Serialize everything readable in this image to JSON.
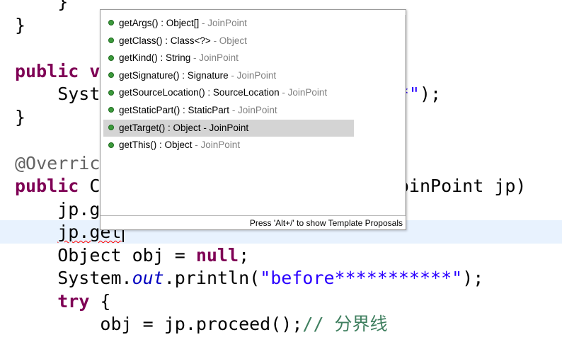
{
  "editor": {
    "lines": [
      {
        "tokens": [
          {
            "t": "    }",
            "c": ""
          }
        ]
      },
      {
        "tokens": [
          {
            "t": "}",
            "c": ""
          }
        ]
      },
      {
        "tokens": [
          {
            "t": "",
            "c": ""
          }
        ]
      },
      {
        "tokens": [
          {
            "t": "public",
            "c": "kw"
          },
          {
            "t": " v",
            "c": "kw"
          }
        ]
      },
      {
        "tokens": [
          {
            "t": "    Syst",
            "c": ""
          },
          {
            "t": "                          ***\"",
            "c": "str"
          },
          {
            "t": ");",
            "c": ""
          }
        ]
      },
      {
        "tokens": [
          {
            "t": "}",
            "c": ""
          }
        ]
      },
      {
        "tokens": [
          {
            "t": "",
            "c": ""
          }
        ]
      },
      {
        "tokens": [
          {
            "t": "@Overric",
            "c": "ann"
          }
        ]
      },
      {
        "tokens": [
          {
            "t": "public",
            "c": "kw"
          },
          {
            "t": " C",
            "c": ""
          },
          {
            "t": "                          gJoinPoint jp)",
            "c": ""
          }
        ]
      },
      {
        "tokens": [
          {
            "t": "    jp.g",
            "c": ""
          },
          {
            "t": "      ();",
            "c": ""
          }
        ]
      },
      {
        "tokens": [
          {
            "t": "    ",
            "c": ""
          },
          {
            "t": "jp.get",
            "c": "err"
          }
        ],
        "current": true,
        "caret": true
      },
      {
        "tokens": [
          {
            "t": "    Object obj = ",
            "c": ""
          },
          {
            "t": "null",
            "c": "kw"
          },
          {
            "t": ";",
            "c": ""
          }
        ]
      },
      {
        "tokens": [
          {
            "t": "    System.",
            "c": ""
          },
          {
            "t": "out",
            "c": "fld"
          },
          {
            "t": ".println(",
            "c": ""
          },
          {
            "t": "\"before***********\"",
            "c": "str"
          },
          {
            "t": ");",
            "c": ""
          }
        ]
      },
      {
        "tokens": [
          {
            "t": "    ",
            "c": ""
          },
          {
            "t": "try",
            "c": "kw"
          },
          {
            "t": " {",
            "c": ""
          }
        ]
      },
      {
        "tokens": [
          {
            "t": "        obj = jp.proceed();",
            "c": ""
          },
          {
            "t": "// 分界线",
            "c": "cmt"
          }
        ]
      }
    ]
  },
  "assist": {
    "proposals": [
      {
        "signature": "getArgs() : Object[]",
        "owner": " - JoinPoint",
        "icon": "public-method-icon"
      },
      {
        "signature": "getClass() : Class<?>",
        "owner": " - Object",
        "icon": "public-method-icon"
      },
      {
        "signature": "getKind() : String",
        "owner": " - JoinPoint",
        "icon": "public-method-icon"
      },
      {
        "signature": "getSignature() : Signature",
        "owner": " - JoinPoint",
        "icon": "public-method-icon"
      },
      {
        "signature": "getSourceLocation() : SourceLocation",
        "owner": " - JoinPoint",
        "icon": "public-method-icon"
      },
      {
        "signature": "getStaticPart() : StaticPart",
        "owner": " - JoinPoint",
        "icon": "public-method-icon"
      },
      {
        "signature": "getTarget() : Object",
        "owner": " - JoinPoint",
        "icon": "public-method-icon",
        "selected": true
      },
      {
        "signature": "getThis() : Object",
        "owner": " - JoinPoint",
        "icon": "public-method-icon"
      }
    ],
    "footer_hint": "Press 'Alt+/' to show Template Proposals"
  },
  "colors": {
    "keyword": "#7f0055",
    "string": "#2a00ff",
    "field": "#0000c0",
    "annotation": "#646464",
    "comment": "#3f7f5f",
    "current_line": "#e8f2fe",
    "selection": "#d4d4d4",
    "method_icon": "#3c9a3c"
  }
}
